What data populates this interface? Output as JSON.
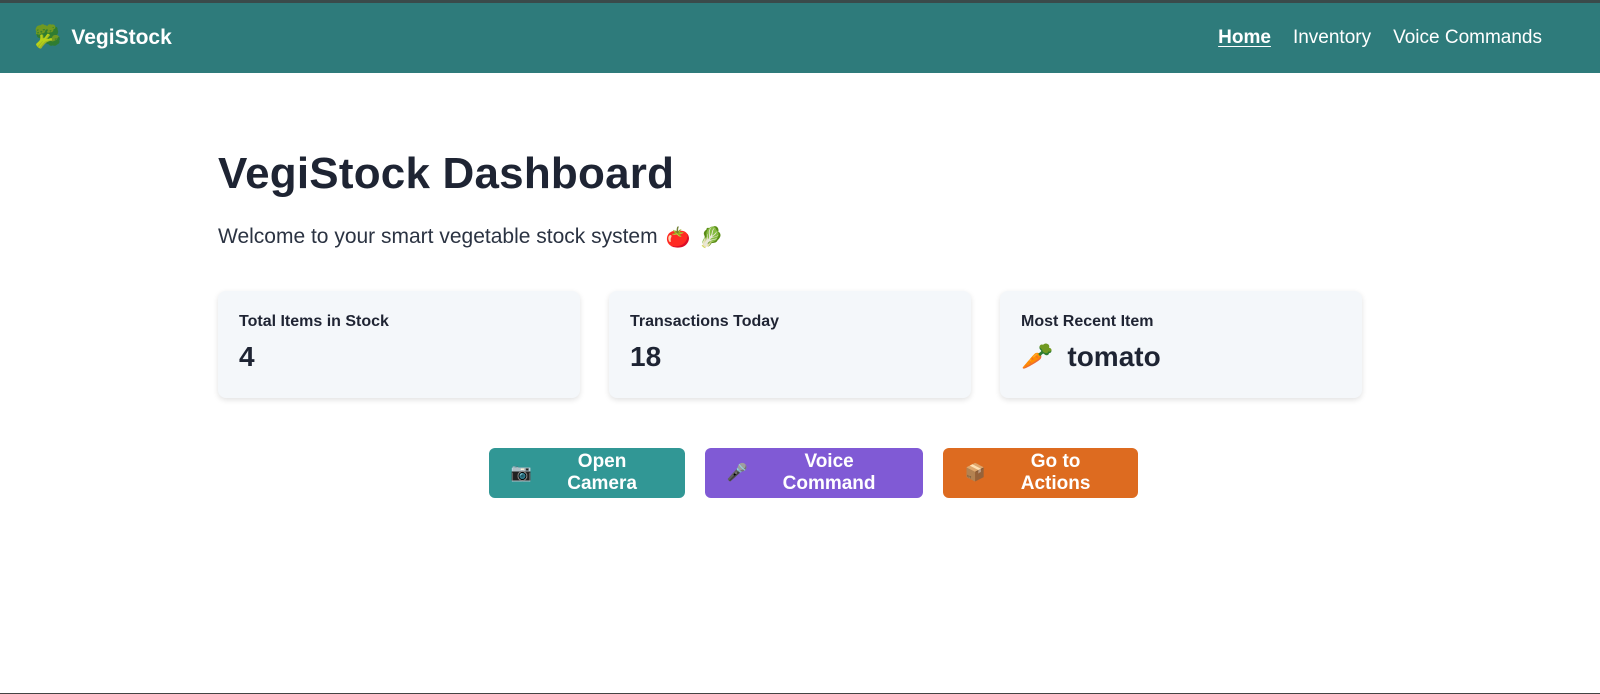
{
  "colors": {
    "navbar": "#2e7b7b",
    "camera_button": "#319795",
    "voice_button": "#805ad5",
    "actions_button": "#dd6b20",
    "card_background": "#f4f7fa"
  },
  "navbar": {
    "brand_icon": "broccoli-icon",
    "brand_name": "VegiStock",
    "links": [
      {
        "label": "Home",
        "active": true
      },
      {
        "label": "Inventory",
        "active": false
      },
      {
        "label": "Voice Commands",
        "active": false
      }
    ]
  },
  "main": {
    "title": "VegiStock Dashboard",
    "subtitle": "Welcome to your smart vegetable stock system",
    "subtitle_icons": [
      "tomato-icon",
      "lettuce-icon"
    ]
  },
  "cards": [
    {
      "label": "Total Items in Stock",
      "value": "4"
    },
    {
      "label": "Transactions Today",
      "value": "18"
    },
    {
      "label": "Most Recent Item",
      "value": "tomato",
      "icon": "carrot-icon"
    }
  ],
  "actions": [
    {
      "label": "Open Camera",
      "icon": "camera-icon"
    },
    {
      "label": "Voice Command",
      "icon": "microphone-icon"
    },
    {
      "label": "Go to Actions",
      "icon": "package-icon"
    }
  ]
}
